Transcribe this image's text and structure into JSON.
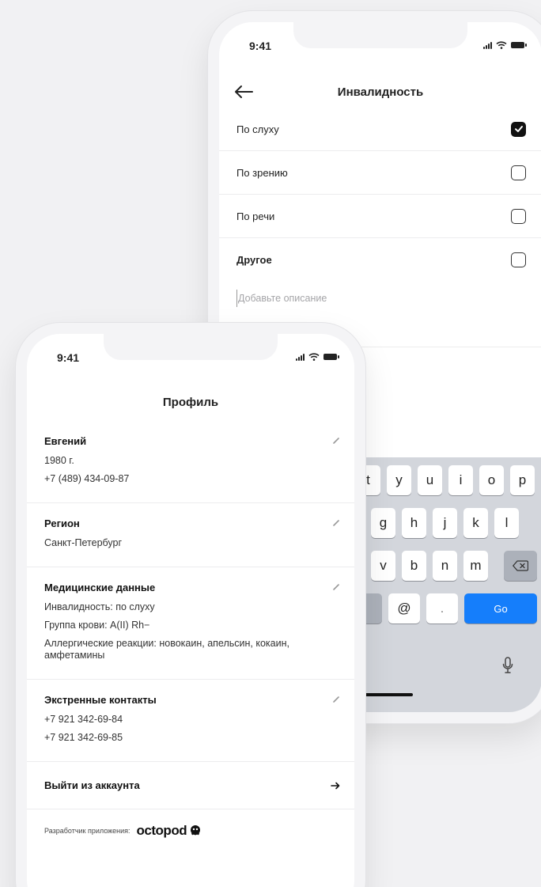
{
  "status": {
    "time": "9:41"
  },
  "disability_screen": {
    "title": "Инвалидность",
    "options": [
      {
        "label": "По слуху",
        "checked": true
      },
      {
        "label": "По зрению",
        "checked": false
      },
      {
        "label": "По речи",
        "checked": false
      },
      {
        "label": "Другое",
        "checked": false
      }
    ],
    "description_placeholder": "Добавьте описание"
  },
  "keyboard": {
    "row1": [
      "t",
      "y",
      "u",
      "i",
      "o",
      "p"
    ],
    "row2": [
      "g",
      "h",
      "j",
      "k",
      "l"
    ],
    "row3": [
      "v",
      "b",
      "n",
      "m"
    ],
    "row4": {
      "at": "@",
      "dot": ".",
      "go": "Go"
    }
  },
  "profile_screen": {
    "title": "Профиль",
    "person": {
      "name": "Евгений",
      "birth": "1980 г.",
      "phone": "+7 (489) 434-09-87"
    },
    "region": {
      "title": "Регион",
      "value": "Санкт-Петербург"
    },
    "medical": {
      "title": "Медицинские данные",
      "disability": "Инвалидность: по слуху",
      "blood": "Группа крови: A(II) Rh−",
      "allergies": "Аллергические реакции: новокаин, апельсин, кокаин, амфетамины"
    },
    "emergency": {
      "title": "Экстренные контакты",
      "contact1": "+7 921 342-69-84",
      "contact2": "+7 921 342-69-85"
    },
    "logout_label": "Выйти из аккаунта",
    "developer_label": "Разработчик приложения:",
    "developer_name": "octopod"
  },
  "colors": {
    "accent_go": "#157efb",
    "keyboard_bg": "#d3d6dc",
    "page_bg": "#f1f1f3"
  },
  "icons": [
    "back-arrow-icon",
    "pencil-icon",
    "arrow-right-icon",
    "backspace-icon",
    "mic-icon",
    "checkmark-icon",
    "octopod-logo-icon"
  ]
}
